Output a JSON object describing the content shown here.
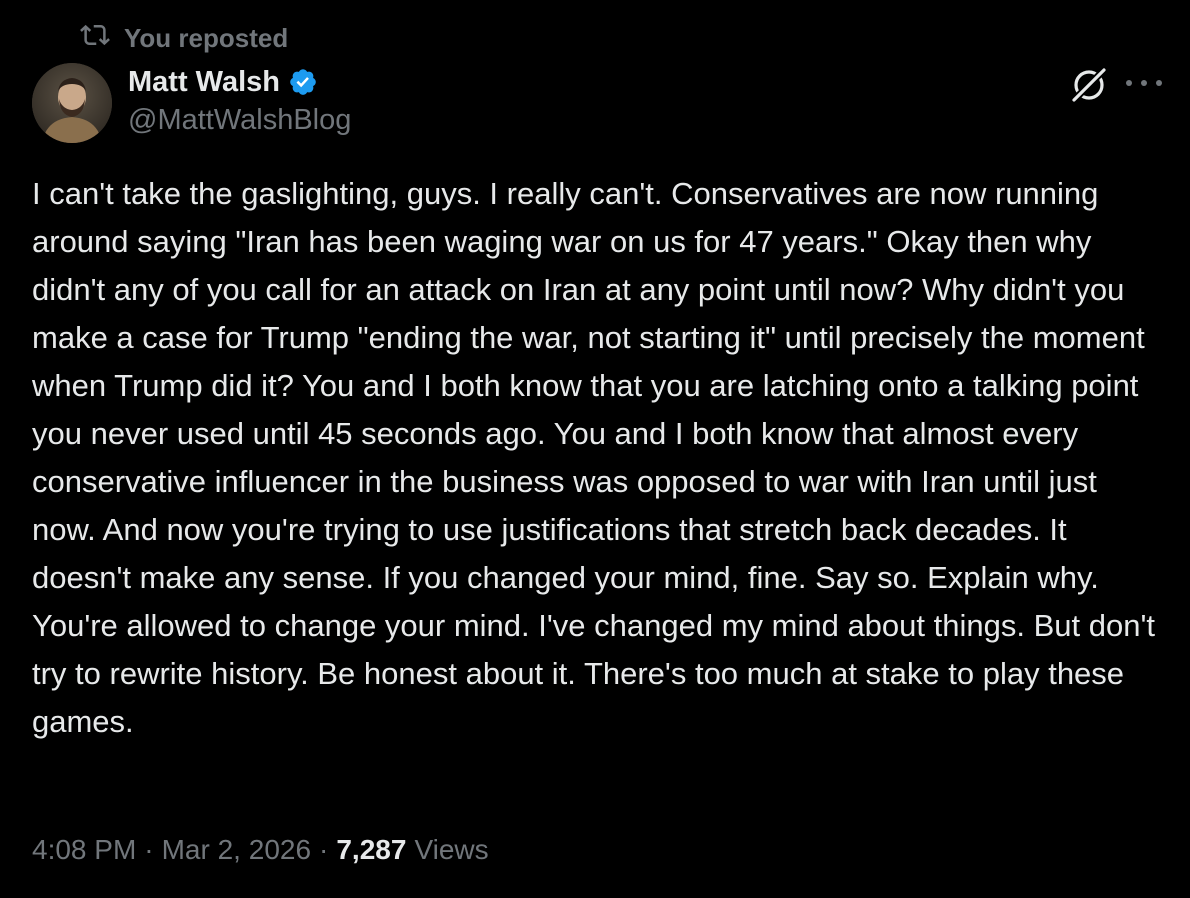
{
  "repost": {
    "label": "You reposted",
    "icon": "repost-icon"
  },
  "author": {
    "display_name": "Matt Walsh",
    "handle": "@MattWalshBlog",
    "verified": true,
    "verified_color": "#1d9bf0"
  },
  "actions": {
    "grok_icon": "grok-icon",
    "more_icon": "more-horizontal-icon"
  },
  "tweet": {
    "text": "I can't take the gaslighting, guys. I really can't. Conservatives are now running around saying \"Iran has been waging war on us for 47 years.\" Okay then why didn't any of you call for an attack on Iran at any point until now? Why didn't you make a case for Trump \"ending the war, not starting it\" until precisely the moment when Trump did it? You and I both know that you are latching onto a talking point you never used until 45 seconds ago. You and I both know that almost every conservative influencer in the business was opposed to war with Iran until just now. And now you're trying to use justifications that stretch back decades. It doesn't make any sense. If you changed your mind, fine. Say so. Explain why. You're allowed to change your mind. I've changed my mind about things. But don't try to rewrite history. Be honest about it. There's too much at stake to play these games."
  },
  "meta": {
    "time": "4:08 PM",
    "separator": "·",
    "date": "Mar 2, 2026",
    "views_count": "7,287",
    "views_label": "Views"
  },
  "colors": {
    "background": "#000000",
    "text_primary": "#e7e9ea",
    "text_secondary": "#71767b"
  }
}
